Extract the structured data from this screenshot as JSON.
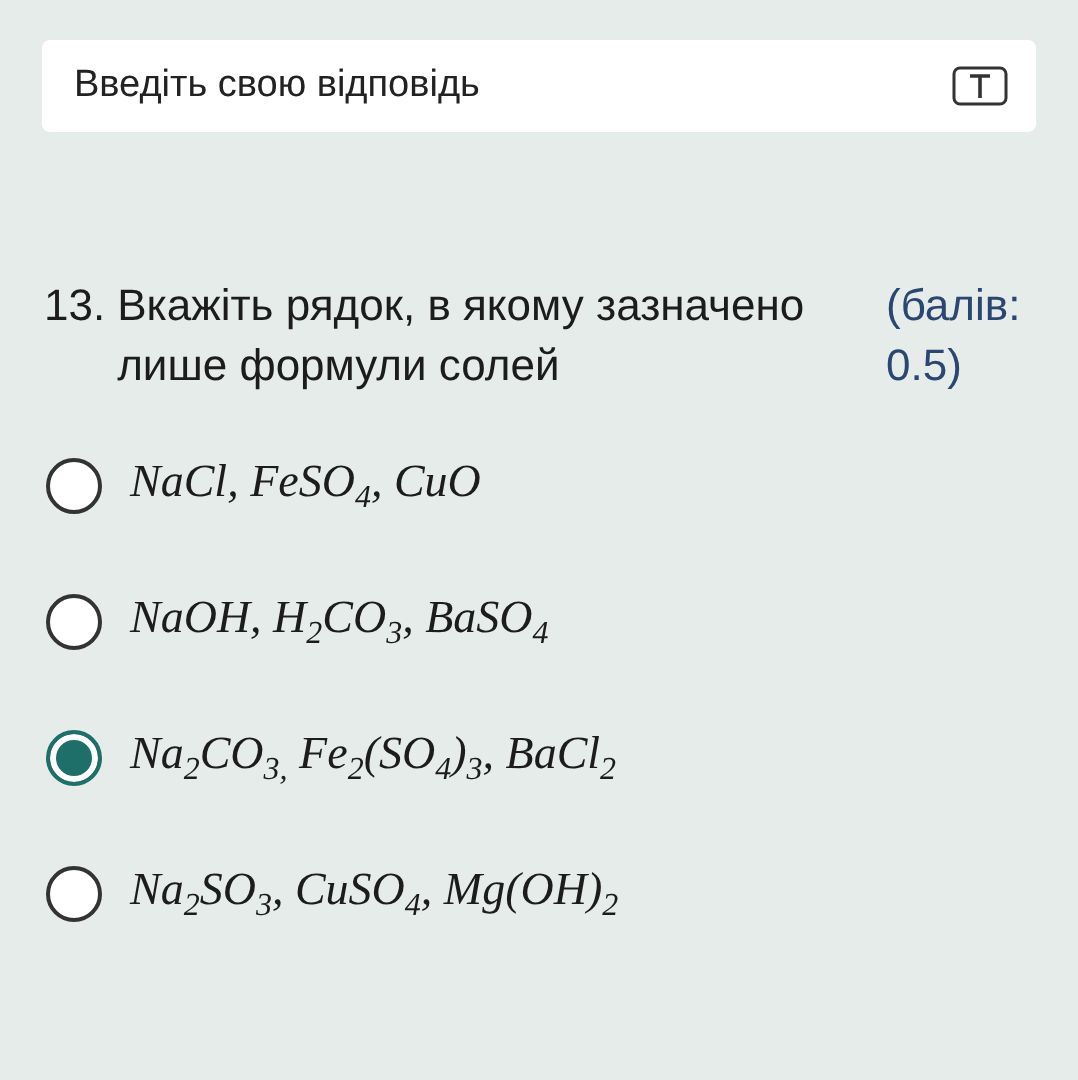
{
  "answer_field": {
    "placeholder": "Введіть свою відповідь"
  },
  "question": {
    "number": "13.",
    "text": "Вкажіть рядок, в якому зазначено лише формули солей",
    "points": "(балів: 0.5)"
  },
  "options": [
    {
      "text": "NaCl, FeSO$_{4}$, CuO",
      "selected": false
    },
    {
      "text": "NaOH, H$_{2}$CO$_{3}$, BaSO$_{4}$",
      "selected": false
    },
    {
      "text": "Na$_{2}$CO$_{3,}$ Fe$_{2}$(SO$_{4}$)$_{3}$, BaCl$_{2}$",
      "selected": true
    },
    {
      "text": "Na$_{2}$SO$_{3}$, CuSO$_{4}$, Mg(OH)$_{2}$",
      "selected": false
    }
  ]
}
